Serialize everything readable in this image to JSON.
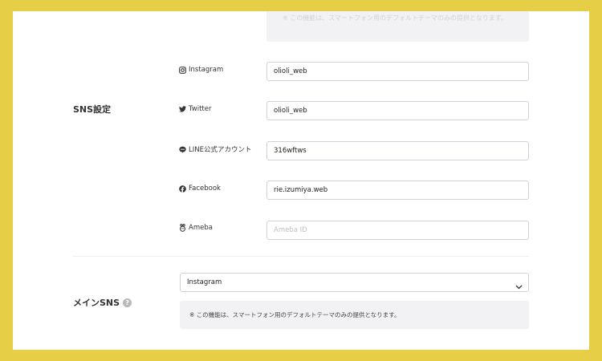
{
  "top_note": {
    "text": "※ この機能は、スマートフォン用のデフォルトテーマのみの提供となります。"
  },
  "sns_settings": {
    "title": "SNS設定",
    "rows": [
      {
        "label": "Instagram",
        "icon": "instagram-icon",
        "value": "olioli_web",
        "placeholder": ""
      },
      {
        "label": "Twitter",
        "icon": "twitter-icon",
        "value": "olioli_web",
        "placeholder": ""
      },
      {
        "label": "LINE公式アカウント",
        "icon": "line-icon",
        "value": "316wftws",
        "placeholder": ""
      },
      {
        "label": "Facebook",
        "icon": "facebook-icon",
        "value": "rie.izumiya.web",
        "placeholder": ""
      },
      {
        "label": "Ameba",
        "icon": "ameba-icon",
        "value": "",
        "placeholder": "Ameba ID"
      }
    ]
  },
  "main_sns": {
    "title": "メインSNS",
    "help_symbol": "?",
    "selected": "Instagram",
    "notice": "※ この機能は、スマートフォン用のデフォルトテーマのみの提供となります。"
  },
  "colors": {
    "frame": "#e6cf47",
    "panel": "#ffffff",
    "note_bg": "#f2f2f4",
    "border": "#cfd2d6"
  }
}
